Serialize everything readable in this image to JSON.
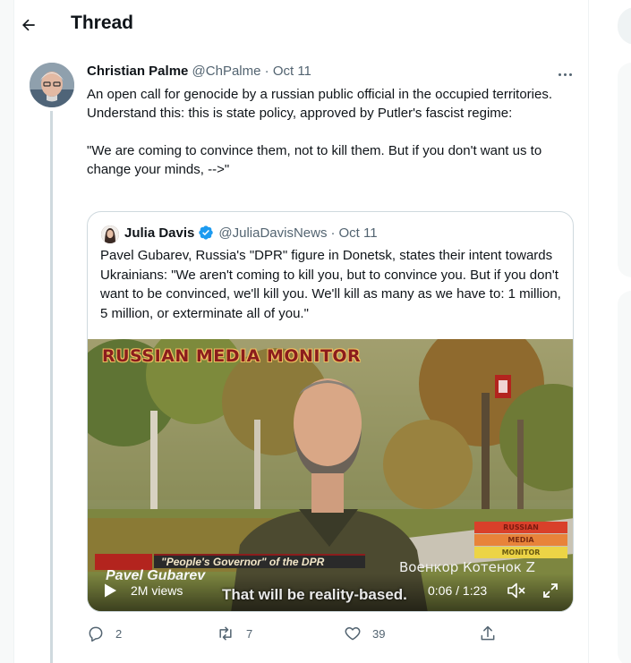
{
  "header": {
    "title": "Thread",
    "back_icon": "arrow-left-icon"
  },
  "tweet": {
    "author_name": "Christian Palme",
    "handle": "@ChPalme",
    "separator": "·",
    "date": "Oct 11",
    "text_para1": "An open call for genocide by a russian public official in the occupied territories. Understand this: this is state policy, approved by Putler's fascist regime:",
    "text_para2": "\"We are coming to convince them, not to kill them. But if you don't want us to change your minds, -->\"",
    "more_icon": "more-horizontal-icon"
  },
  "quote": {
    "author_name": "Julia Davis",
    "handle": "@JuliaDavisNews",
    "separator": "·",
    "date": "Oct 11",
    "verified": true,
    "text": "Pavel Gubarev, Russia's \"DPR\" figure in Donetsk, states their intent towards Ukrainians: \"We aren't coming to kill you, but to convince you. But if you don't want to be convinced, we'll kill you. We'll kill as many as we have to: 1 million, 5 million, or exterminate all of you.\""
  },
  "video": {
    "overlay_title": "RUSSIAN MEDIA MONITOR",
    "logo_lines": [
      "RUSSIAN",
      "MEDIA",
      "MONITOR"
    ],
    "lower_third_top": "\"People's Governor\" of the DPR",
    "lower_third_name": "Pavel Gubarev",
    "corner_text": "Военкор Котенок Z",
    "subtitle": "That will be reality-based.",
    "views": "2M views",
    "time": "0:06 / 1:23"
  },
  "actions": {
    "replies": "2",
    "retweets": "7",
    "likes": "39"
  },
  "colors": {
    "accent": "#1d9bf0",
    "muted": "#536471",
    "border": "#cfd9de"
  }
}
